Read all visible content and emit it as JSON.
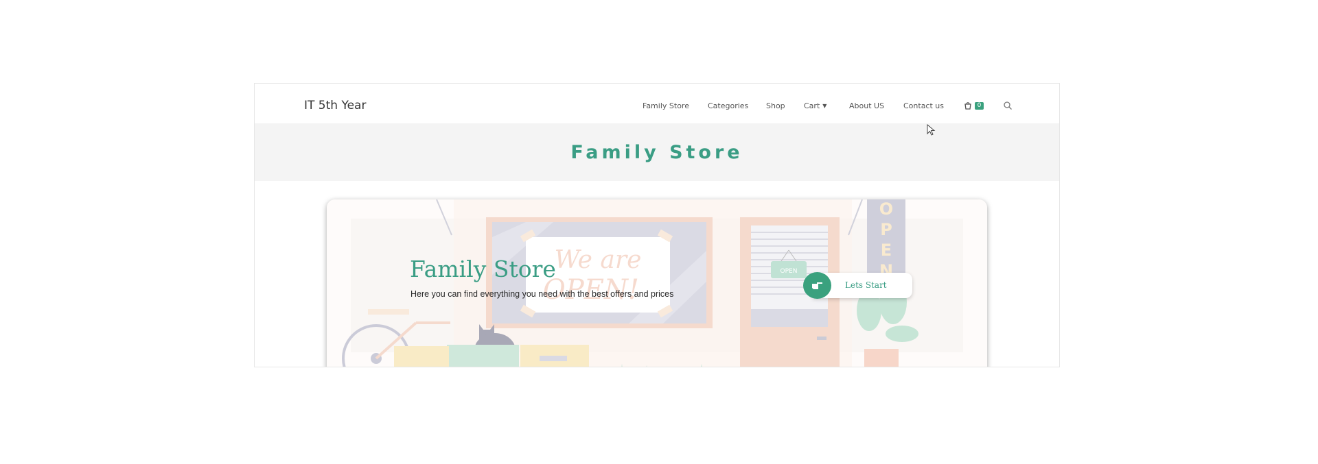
{
  "header": {
    "brand": "IT 5th Year",
    "nav": [
      {
        "label": "Family Store"
      },
      {
        "label": "Categories"
      },
      {
        "label": "Shop"
      },
      {
        "label": "Cart"
      },
      {
        "label": "About US"
      },
      {
        "label": "Contact us"
      }
    ],
    "cart_count": "0",
    "icons": [
      "cart-icon",
      "search-icon",
      "chevron-down-icon"
    ]
  },
  "page_title": "Family Store",
  "hero": {
    "title": "Family Store",
    "subtitle": "Here you can find everything you need with the best offers and prices",
    "cta_label": "Lets Start",
    "cta_icon": "pointing-hand-icon",
    "sign_text": "We are OPEN!",
    "door_sign": "OPEN",
    "vertical_sign": "OPEN"
  },
  "colors": {
    "accent": "#3a9d84",
    "badge": "#3aa17e",
    "band": "#f4f4f4"
  }
}
